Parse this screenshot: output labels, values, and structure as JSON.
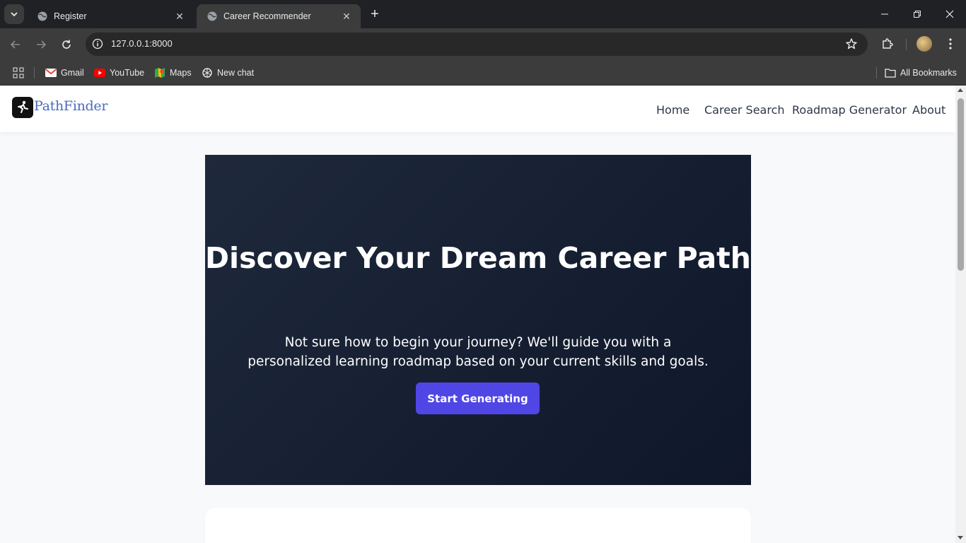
{
  "browser": {
    "tabs": [
      {
        "title": "Register",
        "active": false
      },
      {
        "title": "Career Recommender",
        "active": true
      }
    ],
    "url": "127.0.0.1:8000",
    "bookmarks": [
      {
        "label": "Gmail",
        "icon": "gmail-icon"
      },
      {
        "label": "YouTube",
        "icon": "youtube-icon"
      },
      {
        "label": "Maps",
        "icon": "maps-icon"
      },
      {
        "label": "New chat",
        "icon": "chatgpt-icon"
      }
    ],
    "all_bookmarks": "All Bookmarks"
  },
  "site": {
    "brand": "PathFinder",
    "nav": [
      "Home",
      "Career Search",
      "Roadmap Generator",
      "About"
    ]
  },
  "hero": {
    "title": "Discover Your Dream Career Path",
    "subtitle": "Not sure how to begin your journey? We'll guide you with a personalized learning roadmap based on your current skills and goals.",
    "cta": "Start Generating"
  },
  "colors": {
    "accent": "#4f46e5",
    "hero_bg": "#1e293b",
    "brand": "#4a6bbd"
  }
}
